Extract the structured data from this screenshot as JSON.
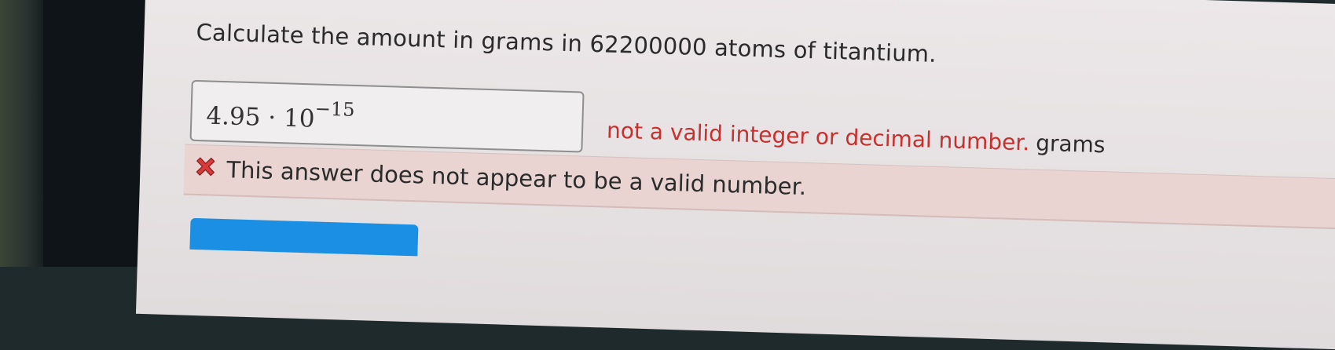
{
  "question": {
    "text": "Calculate the amount in grams in 62200000 atoms of titantium."
  },
  "answer": {
    "mantissa": "4.95",
    "operator": "·",
    "base": "10",
    "exponent": "−15"
  },
  "validation": {
    "message": "not a valid integer or decimal number.",
    "unit": "grams"
  },
  "feedback": {
    "icon": "x-icon",
    "message": "This answer does not appear to be a valid number.",
    "icon_color": "#d63a3a"
  },
  "colors": {
    "error_text": "#c7302c",
    "feedback_background": "#e9d4d2",
    "button_blue": "#1a8fe3"
  }
}
